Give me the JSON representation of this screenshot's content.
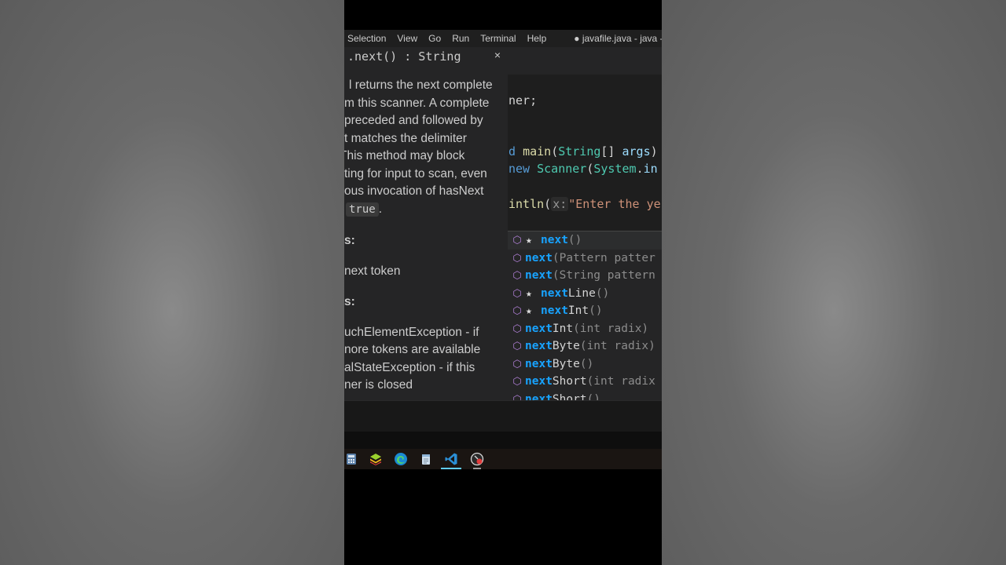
{
  "menu": {
    "items": [
      "Selection",
      "View",
      "Go",
      "Run",
      "Terminal",
      "Help"
    ],
    "window_title": "● javafile.java - java - V"
  },
  "hover": {
    "signature": ".next() : String",
    "close_glyph": "×",
    "description_lines": [
      "l returns the next complete",
      "m this scanner. A complete",
      "preceded and followed by",
      "t matches the delimiter",
      "This method may block",
      "ting for input to scan, even",
      "ous invocation of hasNext"
    ],
    "description_tail_code": "true",
    "description_tail_text": ".",
    "returns_heading": "s:",
    "returns_text": "next token",
    "throws_heading": "s:",
    "throws_lines": [
      "uchElementException - if",
      "nore tokens are available",
      "alStateException - if this",
      "ner is closed"
    ]
  },
  "code": {
    "line1_text": "ner;",
    "line2_method": "d ",
    "line2_name": "main",
    "line2_params_open": "(",
    "line2_type": "String",
    "line2_brackets": "[] ",
    "line2_arg": "args",
    "line2_close": ")",
    "line3_kw": "new ",
    "line3_type": "Scanner",
    "line3_paren": "(",
    "line3_cls": "System",
    "line3_dot": ".",
    "line3_field": "in",
    "line4_fn": "intln",
    "line4_paren": "(",
    "line4_hint": "x:",
    "line4_str": "\"Enter the ye"
  },
  "suggestions": [
    {
      "match": "next",
      "rest": "",
      "args": "()",
      "starred": true,
      "selected": true
    },
    {
      "match": "next",
      "rest": "",
      "args": "(Pattern patter",
      "starred": false,
      "selected": false
    },
    {
      "match": "next",
      "rest": "",
      "args": "(String pattern",
      "starred": false,
      "selected": false
    },
    {
      "match": "next",
      "rest": "Line",
      "args": "()",
      "starred": true,
      "selected": false
    },
    {
      "match": "next",
      "rest": "Int",
      "args": "()",
      "starred": true,
      "selected": false
    },
    {
      "match": "next",
      "rest": "Int",
      "args": "(int radix)",
      "starred": false,
      "selected": false
    },
    {
      "match": "next",
      "rest": "Byte",
      "args": "(int radix)",
      "starred": false,
      "selected": false
    },
    {
      "match": "next",
      "rest": "Byte",
      "args": "()",
      "starred": false,
      "selected": false
    },
    {
      "match": "next",
      "rest": "Short",
      "args": "(int radix",
      "starred": false,
      "selected": false
    },
    {
      "match": "next",
      "rest": "Short",
      "args": "()",
      "starred": false,
      "selected": false
    }
  ],
  "icons": {
    "method": "method-cube-icon",
    "star": "star-icon"
  },
  "taskbar": [
    "calculator-icon",
    "bluestacks-icon",
    "edge-icon",
    "notepad-icon",
    "vscode-icon",
    "recorder-icon"
  ],
  "colors": {
    "match_highlight": "#18a3ff",
    "method_icon": "#b180d7",
    "active_indicator": "#60cdff"
  }
}
